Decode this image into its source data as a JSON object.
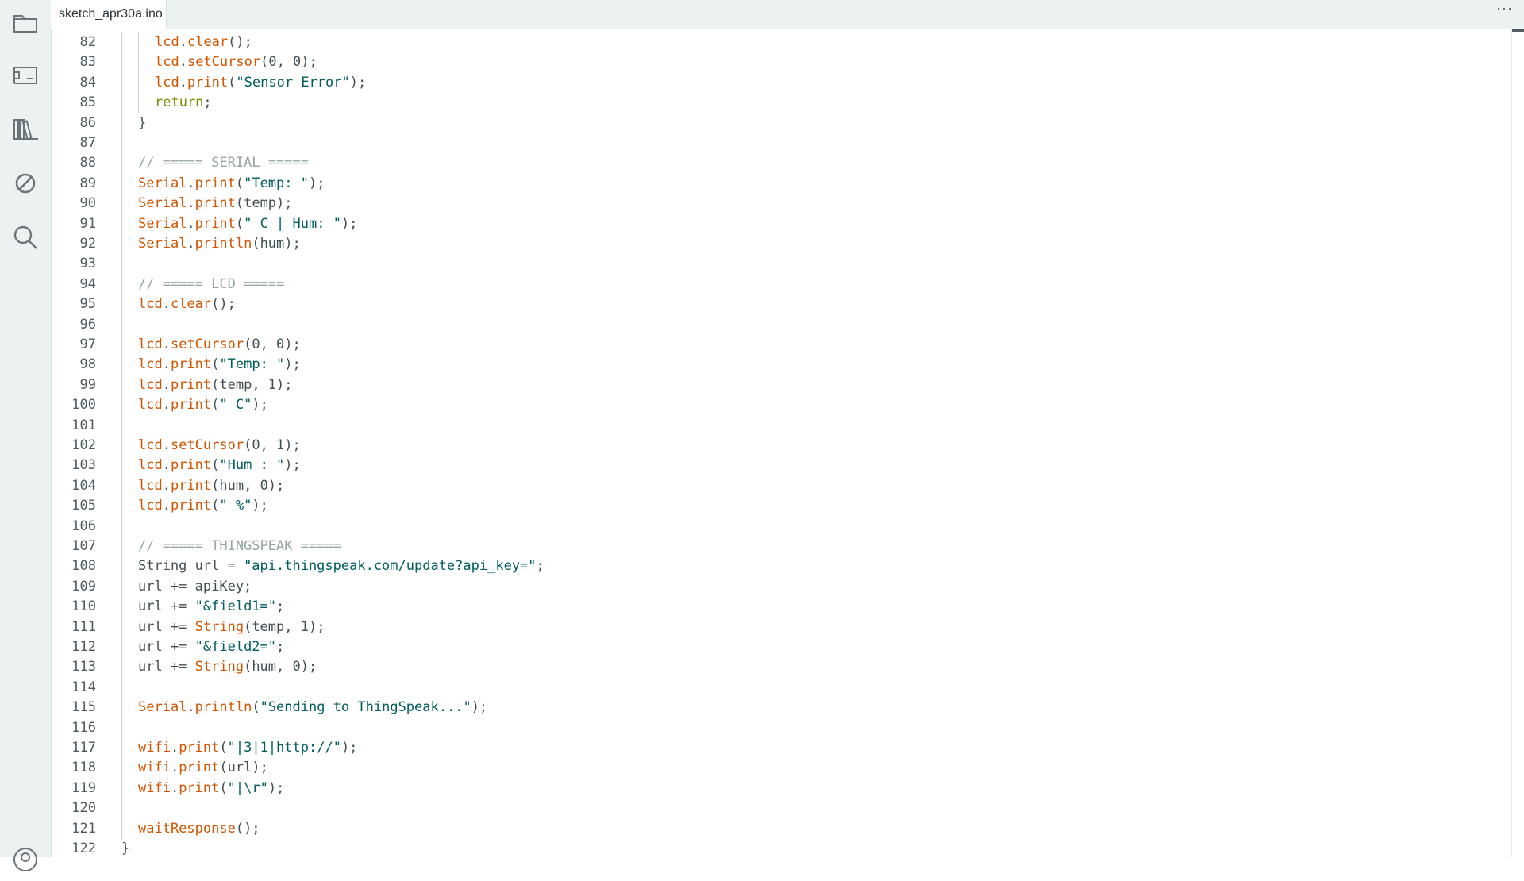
{
  "tab": {
    "filename": "sketch_apr30a.ino",
    "more_label": "···"
  },
  "sidebar": [
    {
      "name": "sketchbook-icon"
    },
    {
      "name": "boards-manager-icon"
    },
    {
      "name": "library-manager-icon"
    },
    {
      "name": "debug-icon"
    },
    {
      "name": "search-icon"
    },
    {
      "name": "profile-icon"
    }
  ],
  "colors": {
    "function": "#d35400",
    "string": "#005c5f",
    "comment": "#95a5a6",
    "keyword": "#728e00",
    "text": "#434f54"
  },
  "code": [
    {
      "n": "82",
      "indent": 2,
      "tokens": [
        [
          "obj",
          "lcd"
        ],
        [
          "pl",
          "."
        ],
        [
          "fn",
          "clear"
        ],
        [
          "pl",
          "();"
        ]
      ]
    },
    {
      "n": "83",
      "indent": 2,
      "tokens": [
        [
          "obj",
          "lcd"
        ],
        [
          "pl",
          "."
        ],
        [
          "fn",
          "setCursor"
        ],
        [
          "pl",
          "(0, 0);"
        ]
      ]
    },
    {
      "n": "84",
      "indent": 2,
      "tokens": [
        [
          "obj",
          "lcd"
        ],
        [
          "pl",
          "."
        ],
        [
          "fn",
          "print"
        ],
        [
          "pl",
          "("
        ],
        [
          "str",
          "\"Sensor Error\""
        ],
        [
          "pl",
          ");"
        ]
      ]
    },
    {
      "n": "85",
      "indent": 2,
      "tokens": [
        [
          "kw",
          "return"
        ],
        [
          "pl",
          ";"
        ]
      ]
    },
    {
      "n": "86",
      "indent": 1,
      "tokens": [
        [
          "pl",
          "}"
        ]
      ]
    },
    {
      "n": "87",
      "indent": 1,
      "tokens": []
    },
    {
      "n": "88",
      "indent": 1,
      "tokens": [
        [
          "cm",
          "// ===== SERIAL ====="
        ]
      ]
    },
    {
      "n": "89",
      "indent": 1,
      "tokens": [
        [
          "obj",
          "Serial"
        ],
        [
          "pl",
          "."
        ],
        [
          "fn",
          "print"
        ],
        [
          "pl",
          "("
        ],
        [
          "str",
          "\"Temp: \""
        ],
        [
          "pl",
          ");"
        ]
      ]
    },
    {
      "n": "90",
      "indent": 1,
      "tokens": [
        [
          "obj",
          "Serial"
        ],
        [
          "pl",
          "."
        ],
        [
          "fn",
          "print"
        ],
        [
          "pl",
          "(temp);"
        ]
      ]
    },
    {
      "n": "91",
      "indent": 1,
      "tokens": [
        [
          "obj",
          "Serial"
        ],
        [
          "pl",
          "."
        ],
        [
          "fn",
          "print"
        ],
        [
          "pl",
          "("
        ],
        [
          "str",
          "\" C | Hum: \""
        ],
        [
          "pl",
          ");"
        ]
      ]
    },
    {
      "n": "92",
      "indent": 1,
      "tokens": [
        [
          "obj",
          "Serial"
        ],
        [
          "pl",
          "."
        ],
        [
          "fn",
          "println"
        ],
        [
          "pl",
          "(hum);"
        ]
      ]
    },
    {
      "n": "93",
      "indent": 1,
      "tokens": []
    },
    {
      "n": "94",
      "indent": 1,
      "tokens": [
        [
          "cm",
          "// ===== LCD ====="
        ]
      ]
    },
    {
      "n": "95",
      "indent": 1,
      "tokens": [
        [
          "obj",
          "lcd"
        ],
        [
          "pl",
          "."
        ],
        [
          "fn",
          "clear"
        ],
        [
          "pl",
          "();"
        ]
      ]
    },
    {
      "n": "96",
      "indent": 1,
      "tokens": []
    },
    {
      "n": "97",
      "indent": 1,
      "tokens": [
        [
          "obj",
          "lcd"
        ],
        [
          "pl",
          "."
        ],
        [
          "fn",
          "setCursor"
        ],
        [
          "pl",
          "(0, 0);"
        ]
      ]
    },
    {
      "n": "98",
      "indent": 1,
      "tokens": [
        [
          "obj",
          "lcd"
        ],
        [
          "pl",
          "."
        ],
        [
          "fn",
          "print"
        ],
        [
          "pl",
          "("
        ],
        [
          "str",
          "\"Temp: \""
        ],
        [
          "pl",
          ");"
        ]
      ]
    },
    {
      "n": "99",
      "indent": 1,
      "tokens": [
        [
          "obj",
          "lcd"
        ],
        [
          "pl",
          "."
        ],
        [
          "fn",
          "print"
        ],
        [
          "pl",
          "(temp, 1);"
        ]
      ]
    },
    {
      "n": "100",
      "indent": 1,
      "tokens": [
        [
          "obj",
          "lcd"
        ],
        [
          "pl",
          "."
        ],
        [
          "fn",
          "print"
        ],
        [
          "pl",
          "("
        ],
        [
          "str",
          "\" C\""
        ],
        [
          "pl",
          ");"
        ]
      ]
    },
    {
      "n": "101",
      "indent": 1,
      "tokens": []
    },
    {
      "n": "102",
      "indent": 1,
      "tokens": [
        [
          "obj",
          "lcd"
        ],
        [
          "pl",
          "."
        ],
        [
          "fn",
          "setCursor"
        ],
        [
          "pl",
          "(0, 1);"
        ]
      ]
    },
    {
      "n": "103",
      "indent": 1,
      "tokens": [
        [
          "obj",
          "lcd"
        ],
        [
          "pl",
          "."
        ],
        [
          "fn",
          "print"
        ],
        [
          "pl",
          "("
        ],
        [
          "str",
          "\"Hum : \""
        ],
        [
          "pl",
          ");"
        ]
      ]
    },
    {
      "n": "104",
      "indent": 1,
      "tokens": [
        [
          "obj",
          "lcd"
        ],
        [
          "pl",
          "."
        ],
        [
          "fn",
          "print"
        ],
        [
          "pl",
          "(hum, 0);"
        ]
      ]
    },
    {
      "n": "105",
      "indent": 1,
      "tokens": [
        [
          "obj",
          "lcd"
        ],
        [
          "pl",
          "."
        ],
        [
          "fn",
          "print"
        ],
        [
          "pl",
          "("
        ],
        [
          "str",
          "\" %\""
        ],
        [
          "pl",
          ");"
        ]
      ]
    },
    {
      "n": "106",
      "indent": 1,
      "tokens": []
    },
    {
      "n": "107",
      "indent": 1,
      "tokens": [
        [
          "cm",
          "// ===== THINGSPEAK ====="
        ]
      ]
    },
    {
      "n": "108",
      "indent": 1,
      "tokens": [
        [
          "pl",
          "String url = "
        ],
        [
          "str",
          "\"api.thingspeak.com/update?api_key=\""
        ],
        [
          "pl",
          ";"
        ]
      ]
    },
    {
      "n": "109",
      "indent": 1,
      "tokens": [
        [
          "pl",
          "url += apiKey;"
        ]
      ]
    },
    {
      "n": "110",
      "indent": 1,
      "tokens": [
        [
          "pl",
          "url += "
        ],
        [
          "str",
          "\"&field1=\""
        ],
        [
          "pl",
          ";"
        ]
      ]
    },
    {
      "n": "111",
      "indent": 1,
      "tokens": [
        [
          "pl",
          "url += "
        ],
        [
          "fn",
          "String"
        ],
        [
          "pl",
          "(temp, 1);"
        ]
      ]
    },
    {
      "n": "112",
      "indent": 1,
      "tokens": [
        [
          "pl",
          "url += "
        ],
        [
          "str",
          "\"&field2=\""
        ],
        [
          "pl",
          ";"
        ]
      ]
    },
    {
      "n": "113",
      "indent": 1,
      "tokens": [
        [
          "pl",
          "url += "
        ],
        [
          "fn",
          "String"
        ],
        [
          "pl",
          "(hum, 0);"
        ]
      ]
    },
    {
      "n": "114",
      "indent": 1,
      "tokens": []
    },
    {
      "n": "115",
      "indent": 1,
      "tokens": [
        [
          "obj",
          "Serial"
        ],
        [
          "pl",
          "."
        ],
        [
          "fn",
          "println"
        ],
        [
          "pl",
          "("
        ],
        [
          "str",
          "\"Sending to ThingSpeak...\""
        ],
        [
          "pl",
          ");"
        ]
      ]
    },
    {
      "n": "116",
      "indent": 1,
      "tokens": []
    },
    {
      "n": "117",
      "indent": 1,
      "tokens": [
        [
          "obj",
          "wifi"
        ],
        [
          "pl",
          "."
        ],
        [
          "fn",
          "print"
        ],
        [
          "pl",
          "("
        ],
        [
          "str",
          "\"|3|1|http://\""
        ],
        [
          "pl",
          ");"
        ]
      ]
    },
    {
      "n": "118",
      "indent": 1,
      "tokens": [
        [
          "obj",
          "wifi"
        ],
        [
          "pl",
          "."
        ],
        [
          "fn",
          "print"
        ],
        [
          "pl",
          "(url);"
        ]
      ]
    },
    {
      "n": "119",
      "indent": 1,
      "tokens": [
        [
          "obj",
          "wifi"
        ],
        [
          "pl",
          "."
        ],
        [
          "fn",
          "print"
        ],
        [
          "pl",
          "("
        ],
        [
          "str",
          "\"|\\r\""
        ],
        [
          "pl",
          ");"
        ]
      ]
    },
    {
      "n": "120",
      "indent": 1,
      "tokens": []
    },
    {
      "n": "121",
      "indent": 1,
      "tokens": [
        [
          "fn",
          "waitResponse"
        ],
        [
          "pl",
          "();"
        ]
      ]
    },
    {
      "n": "122",
      "indent": 0,
      "tokens": [
        [
          "pl",
          "}"
        ]
      ]
    }
  ]
}
